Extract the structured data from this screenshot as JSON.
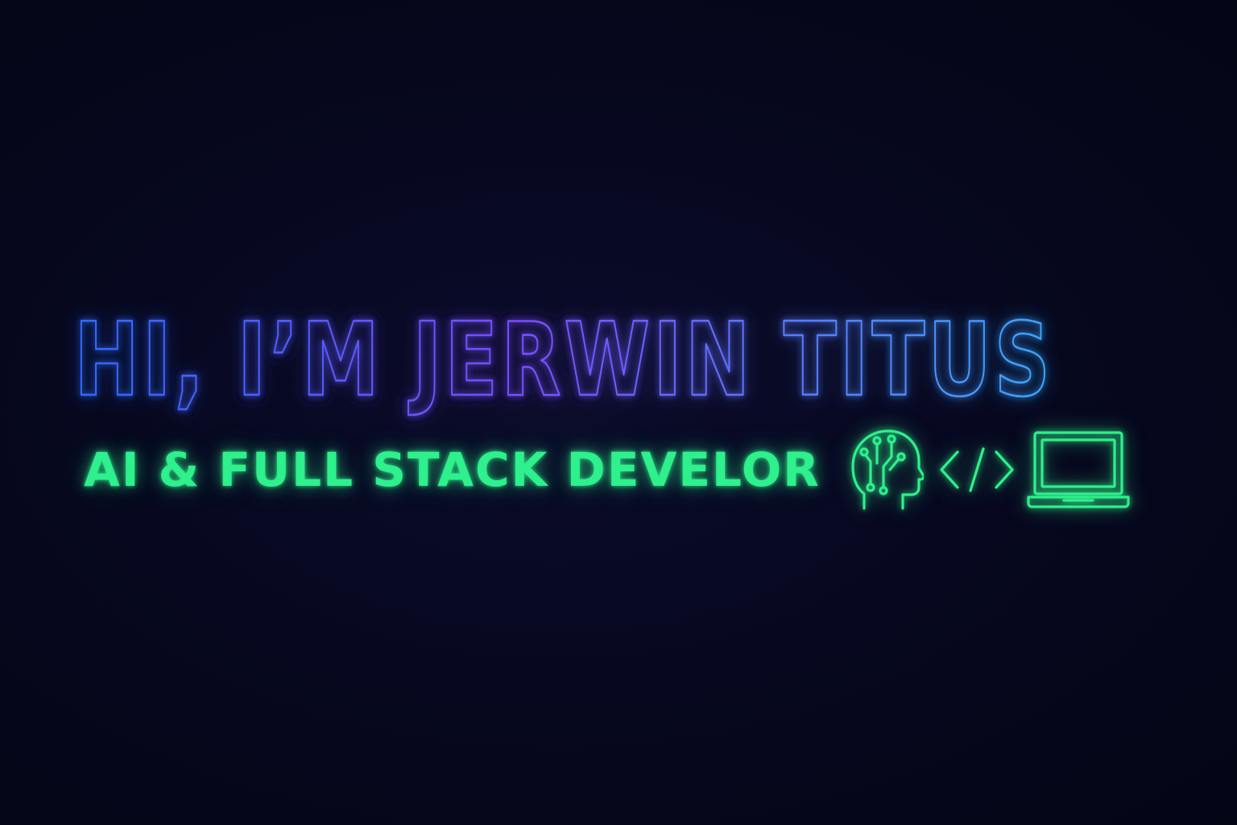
{
  "hero": {
    "headline": "HI, I’M JERWIN TITUS",
    "tagline": "AI & FULL STACK DEVELOR",
    "icons": [
      "ai-brain-head-icon",
      "code-brackets-icon",
      "laptop-icon"
    ]
  },
  "colors": {
    "background": "#05061a",
    "headline_gradient_start": "#2f6bff",
    "headline_gradient_mid": "#7a4dff",
    "headline_gradient_end": "#3aa6ff",
    "tagline": "#2ef08c"
  }
}
